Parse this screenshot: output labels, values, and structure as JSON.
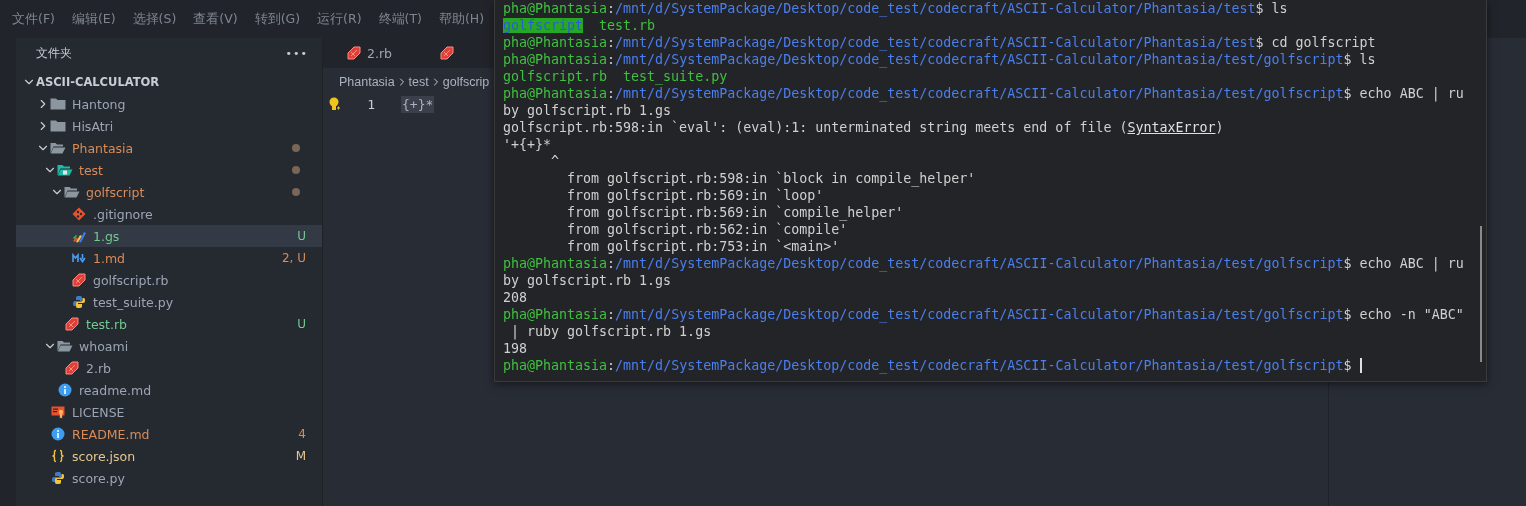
{
  "menu": [
    "文件(F)",
    "编辑(E)",
    "选择(S)",
    "查看(V)",
    "转到(G)",
    "运行(R)",
    "终端(T)",
    "帮助(H)"
  ],
  "sidebar": {
    "title": "文件夹",
    "more": "•••",
    "root": {
      "name": "ASCII-CALCULATOR",
      "expanded": true
    },
    "items": [
      {
        "name": "Hantong",
        "kind": "folder",
        "expanded": false,
        "color": "#9da5b4",
        "dot": false,
        "selected": false
      },
      {
        "name": "HisAtri",
        "kind": "folder",
        "expanded": false,
        "color": "#9da5b4",
        "dot": false,
        "selected": false
      },
      {
        "name": "Phantasia",
        "kind": "folder",
        "expanded": true,
        "color": "#d98c58",
        "dot": true,
        "selected": false,
        "children": [
          {
            "name": "test",
            "kind": "test-folder",
            "expanded": true,
            "color": "#d98c58",
            "dot": true,
            "selected": false,
            "children": [
              {
                "name": "golfscript",
                "kind": "folder",
                "expanded": true,
                "color": "#d98c58",
                "dot": true,
                "selected": false,
                "children": [
                  {
                    "name": ".gitignore",
                    "kind": "git",
                    "color": "#9da5b4",
                    "dot": false,
                    "selected": false
                  },
                  {
                    "name": "1.gs",
                    "kind": "gs",
                    "color": "#73c991",
                    "dot": false,
                    "badge": "U",
                    "selected": true
                  },
                  {
                    "name": "1.md",
                    "kind": "markdown",
                    "color": "#d98c58",
                    "dot": false,
                    "badge": "2, U",
                    "selected": false
                  },
                  {
                    "name": "golfscript.rb",
                    "kind": "ruby",
                    "color": "#9da5b4",
                    "dot": false,
                    "selected": false
                  },
                  {
                    "name": "test_suite.py",
                    "kind": "python",
                    "color": "#9da5b4",
                    "dot": false,
                    "selected": false
                  }
                ]
              },
              {
                "name": "test.rb",
                "kind": "ruby",
                "color": "#73c991",
                "dot": false,
                "badge": "U",
                "selected": false
              }
            ]
          },
          {
            "name": "whoami",
            "kind": "folder",
            "expanded": true,
            "color": "#9da5b4",
            "dot": false,
            "selected": false,
            "children": [
              {
                "name": "2.rb",
                "kind": "ruby",
                "color": "#9da5b4",
                "dot": false,
                "selected": false
              }
            ]
          },
          {
            "name": "readme.md",
            "kind": "info",
            "color": "#9da5b4",
            "dot": false,
            "selected": false
          }
        ]
      },
      {
        "name": "LICENSE",
        "kind": "license",
        "color": "#9da5b4",
        "dot": false,
        "selected": false
      },
      {
        "name": "README.md",
        "kind": "info",
        "color": "#d98c58",
        "dot": false,
        "badge": "4",
        "selected": false
      },
      {
        "name": "score.json",
        "kind": "json",
        "color": "#e5c890",
        "dot": false,
        "badge": "M",
        "selected": false
      },
      {
        "name": "score.py",
        "kind": "python",
        "color": "#9da5b4",
        "dot": false,
        "selected": false
      }
    ]
  },
  "editor": {
    "tabs": [
      {
        "label": "2.rb",
        "kind": "ruby"
      },
      {
        "kind": "ruby"
      }
    ],
    "breadcrumb": [
      "Phantasia",
      "test",
      "golfscrip"
    ],
    "lines": [
      {
        "number": "1",
        "code": "{+}*"
      }
    ]
  },
  "terminal": {
    "lines": [
      {
        "segments": [
          {
            "kind": "user",
            "text": "pha@Phantasia"
          },
          {
            "kind": "plain",
            "text": ":"
          },
          {
            "kind": "path",
            "text": "/mnt/d/SystemPackage/Desktop/code_test/codecraft/ASCII-Calculator/Phantasia/test"
          },
          {
            "kind": "plain",
            "text": "$ ls"
          }
        ]
      },
      {
        "segments": [
          {
            "kind": "dir",
            "text": "golfscript"
          },
          {
            "kind": "file",
            "text": "  test.rb"
          }
        ]
      },
      {
        "segments": [
          {
            "kind": "user",
            "text": "pha@Phantasia"
          },
          {
            "kind": "plain",
            "text": ":"
          },
          {
            "kind": "path",
            "text": "/mnt/d/SystemPackage/Desktop/code_test/codecraft/ASCII-Calculator/Phantasia/test"
          },
          {
            "kind": "plain",
            "text": "$ cd golfscript"
          }
        ]
      },
      {
        "segments": [
          {
            "kind": "user",
            "text": "pha@Phantasia"
          },
          {
            "kind": "plain",
            "text": ":"
          },
          {
            "kind": "path",
            "text": "/mnt/d/SystemPackage/Desktop/code_test/codecraft/ASCII-Calculator/Phantasia/test/golfscript"
          },
          {
            "kind": "plain",
            "text": "$ ls"
          }
        ]
      },
      {
        "segments": [
          {
            "kind": "file",
            "text": "golfscript.rb  test_suite.py"
          }
        ]
      },
      {
        "segments": [
          {
            "kind": "user",
            "text": "pha@Phantasia"
          },
          {
            "kind": "plain",
            "text": ":"
          },
          {
            "kind": "path",
            "text": "/mnt/d/SystemPackage/Desktop/code_test/codecraft/ASCII-Calculator/Phantasia/test/golfscript"
          },
          {
            "kind": "plain",
            "text": "$ echo ABC | ru"
          }
        ]
      },
      {
        "segments": [
          {
            "kind": "plain",
            "text": "by golfscript.rb 1.gs"
          }
        ]
      },
      {
        "segments": [
          {
            "kind": "plain",
            "text": "golfscript.rb:598:in `eval': (eval):1: unterminated string meets end of file ("
          },
          {
            "kind": "link",
            "text": "SyntaxError"
          },
          {
            "kind": "plain",
            "text": ")"
          }
        ]
      },
      {
        "segments": [
          {
            "kind": "plain",
            "text": "'+{+}*"
          }
        ]
      },
      {
        "segments": [
          {
            "kind": "plain",
            "text": "      ^"
          }
        ]
      },
      {
        "segments": [
          {
            "kind": "plain",
            "text": "        from golfscript.rb:598:in `block in compile_helper'"
          }
        ]
      },
      {
        "segments": [
          {
            "kind": "plain",
            "text": "        from golfscript.rb:569:in `loop'"
          }
        ]
      },
      {
        "segments": [
          {
            "kind": "plain",
            "text": "        from golfscript.rb:569:in `compile_helper'"
          }
        ]
      },
      {
        "segments": [
          {
            "kind": "plain",
            "text": "        from golfscript.rb:562:in `compile'"
          }
        ]
      },
      {
        "segments": [
          {
            "kind": "plain",
            "text": "        from golfscript.rb:753:in `<main>'"
          }
        ]
      },
      {
        "segments": [
          {
            "kind": "user",
            "text": "pha@Phantasia"
          },
          {
            "kind": "plain",
            "text": ":"
          },
          {
            "kind": "path",
            "text": "/mnt/d/SystemPackage/Desktop/code_test/codecraft/ASCII-Calculator/Phantasia/test/golfscript"
          },
          {
            "kind": "plain",
            "text": "$ echo ABC | ru"
          }
        ]
      },
      {
        "segments": [
          {
            "kind": "plain",
            "text": "by golfscript.rb 1.gs"
          }
        ]
      },
      {
        "segments": [
          {
            "kind": "plain",
            "text": "208"
          }
        ]
      },
      {
        "segments": [
          {
            "kind": "user",
            "text": "pha@Phantasia"
          },
          {
            "kind": "plain",
            "text": ":"
          },
          {
            "kind": "path",
            "text": "/mnt/d/SystemPackage/Desktop/code_test/codecraft/ASCII-Calculator/Phantasia/test/golfscript"
          },
          {
            "kind": "plain",
            "text": "$ echo -n \"ABC\""
          }
        ]
      },
      {
        "segments": [
          {
            "kind": "plain",
            "text": " | ruby golfscript.rb 1.gs"
          }
        ]
      },
      {
        "segments": [
          {
            "kind": "plain",
            "text": "198"
          }
        ]
      },
      {
        "segments": [
          {
            "kind": "user",
            "text": "pha@Phantasia"
          },
          {
            "kind": "plain",
            "text": ":"
          },
          {
            "kind": "path",
            "text": "/mnt/d/SystemPackage/Desktop/code_test/codecraft/ASCII-Calculator/Phantasia/test/golfscript"
          },
          {
            "kind": "plain",
            "text": "$"
          }
        ],
        "cursor": true
      }
    ]
  }
}
